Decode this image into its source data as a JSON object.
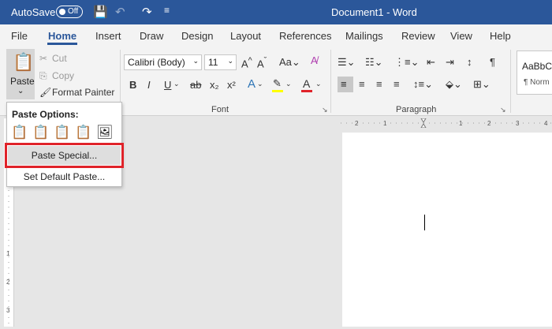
{
  "titlebar": {
    "autosave_label": "AutoSave",
    "autosave_state": "Off",
    "document_title": "Document1 - Word"
  },
  "tabs": [
    "File",
    "Home",
    "Insert",
    "Draw",
    "Design",
    "Layout",
    "References",
    "Mailings",
    "Review",
    "View",
    "Help"
  ],
  "clipboard": {
    "paste": "Paste",
    "cut": "Cut",
    "copy": "Copy",
    "format_painter": "Format Painter"
  },
  "font": {
    "font_name": "Calibri (Body)",
    "font_size": "11",
    "group_label": "Font",
    "bold": "B",
    "italic": "I",
    "underline": "U",
    "strike": "ab",
    "sub": "x₂",
    "sup": "x²"
  },
  "paragraph": {
    "group_label": "Paragraph"
  },
  "styles": {
    "preview": "AaBbCc",
    "normal": "¶ Norm"
  },
  "paste_menu": {
    "header": "Paste Options:",
    "paste_special": "Paste Special...",
    "set_default": "Set Default Paste..."
  },
  "colors": {
    "title_bar": "#2b579a",
    "highlight_border": "#e0232a",
    "font_color_underline": "#e0232a",
    "highlight_color": "#ffff00"
  }
}
